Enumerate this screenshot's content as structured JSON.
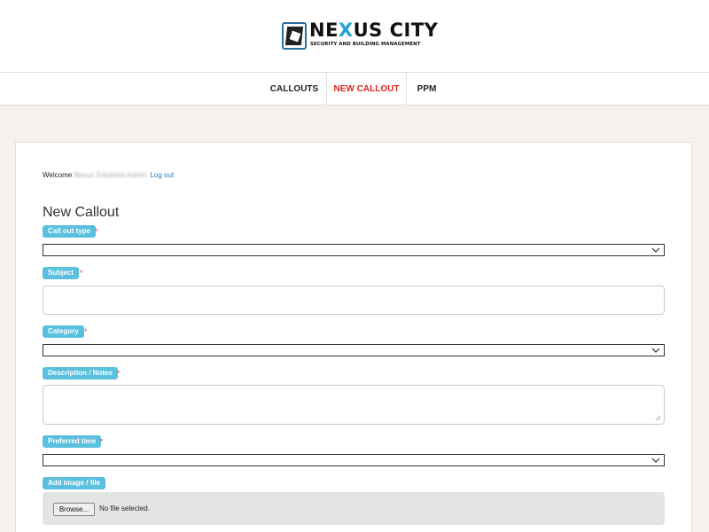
{
  "logo": {
    "title_before": "NE",
    "title_accent": "X",
    "title_after": "US CITY",
    "subtitle": "SECURITY AND BUILDING MANAGEMENT"
  },
  "nav": {
    "items": [
      {
        "label": "CALLOUTS"
      },
      {
        "label": "NEW CALLOUT"
      },
      {
        "label": "PPM"
      }
    ],
    "active_color": "#e0251b"
  },
  "welcome": {
    "prefix": "Welcome",
    "user": "Nexus Solutions Admin",
    "logout": "Log out"
  },
  "page": {
    "title": "New Callout"
  },
  "form": {
    "required_mark": "*",
    "callout_type": {
      "label": "Call out type",
      "value": ""
    },
    "subject": {
      "label": "Subject",
      "value": ""
    },
    "category": {
      "label": "Category",
      "value": ""
    },
    "description": {
      "label": "Description / Notes",
      "value": ""
    },
    "preferred_time": {
      "label": "Preferred time",
      "value": ""
    },
    "attachment": {
      "label": "Add image / file",
      "button": "Browse...",
      "status": "No file selected."
    }
  },
  "colors": {
    "label_bg": "#5bc0de",
    "accent": "#27a3d8",
    "link": "#2a7ab8"
  }
}
